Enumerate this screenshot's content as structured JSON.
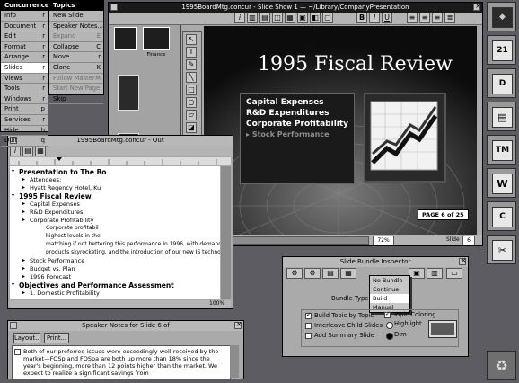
{
  "menu_main": {
    "title": "Concurrence",
    "items": [
      {
        "label": "Info",
        "key": "r"
      },
      {
        "label": "Document",
        "key": "r"
      },
      {
        "label": "Edit",
        "key": "r"
      },
      {
        "label": "Format",
        "key": "r"
      },
      {
        "label": "Arrange",
        "key": "r"
      },
      {
        "label": "Slides",
        "key": "r"
      },
      {
        "label": "Views",
        "key": "r"
      },
      {
        "label": "Tools",
        "key": "r"
      },
      {
        "label": "Windows",
        "key": "r"
      },
      {
        "label": "Print",
        "key": "p"
      },
      {
        "label": "Services",
        "key": "r"
      },
      {
        "label": "Hide",
        "key": "h"
      },
      {
        "label": "Quit",
        "key": "q"
      }
    ]
  },
  "menu_topics": {
    "title": "Topics",
    "items": [
      {
        "label": "New Slide",
        "key": ""
      },
      {
        "label": "Speaker Notes...",
        "key": ""
      },
      {
        "label": "Expand",
        "key": "E"
      },
      {
        "label": "Collapse",
        "key": "C"
      },
      {
        "label": "Move",
        "key": "r"
      },
      {
        "label": "Clone",
        "key": "K"
      },
      {
        "label": "Follow Master",
        "key": "M"
      },
      {
        "label": "Start New Page",
        "key": ""
      },
      {
        "label": "Skip",
        "key": ""
      }
    ]
  },
  "slideshow": {
    "title": "1995BoardMtg.concur - Slide Show 1  —  ~/Library/CompanyPresentation",
    "thumb_finance": "Finance",
    "slide_title": "1995 Fiscal Review",
    "bullets": [
      "Capital Expenses",
      "R&D Expenditures",
      "Corporate Profitability",
      "Stock Performance"
    ],
    "page_badge": "PAGE 6 of 25",
    "zoom": "72%",
    "slide_label": "Slide",
    "slide_num": "6"
  },
  "outline": {
    "title": "1995BoardMtg.concur - Out",
    "lines": [
      {
        "text": "Presentation to The Bo",
        "indent": 0,
        "bold": true
      },
      {
        "text": "Attendees:",
        "indent": 1,
        "bold": false
      },
      {
        "text": "Hyatt Regency Hotel, Ku",
        "indent": 1,
        "bold": false
      },
      {
        "text": "1995 Fiscal Review",
        "indent": 0,
        "bold": true
      },
      {
        "text": "Capital Expenses",
        "indent": 1,
        "bold": false
      },
      {
        "text": "R&D Expenditures",
        "indent": 1,
        "bold": false
      },
      {
        "text": "Corporate Profitability",
        "indent": 1,
        "bold": false
      },
      {
        "text": "Corporate profitabil",
        "indent": 2,
        "bold": false
      },
      {
        "text": "highest levels in the",
        "indent": 2,
        "bold": false
      },
      {
        "text": "matching if not bettering this performance in 1996, with demand for our",
        "indent": 2,
        "bold": false
      },
      {
        "text": "products skyrocketing, and the introduction of our new IS technology.",
        "indent": 2,
        "bold": false
      },
      {
        "text": "Stock Performance",
        "indent": 1,
        "bold": false
      },
      {
        "text": "Budget vs. Plan",
        "indent": 1,
        "bold": false
      },
      {
        "text": "1996 Forecast",
        "indent": 1,
        "bold": false
      },
      {
        "text": "Objectives and Performance Assessment",
        "indent": 0,
        "bold": true
      },
      {
        "text": "1. Domestic Profitability",
        "indent": 1,
        "bold": false
      }
    ],
    "zoom": "100%"
  },
  "notes": {
    "title": "Speaker Notes for Slide 6 of",
    "layout_btn": "Layout...",
    "print_btn": "Print...",
    "text": "Both of our preferred issues were exceedingly well received by the market—FOSp and FOSpa are both up more than 18% since the year's beginning, more than 12 points higher than the market. We expect to realize a significant savings from"
  },
  "inspector": {
    "title": "Slide Bundle Inspector",
    "bundle_type_label": "Bundle Type",
    "options": [
      "No Bundle",
      "Continue",
      "Build",
      "Manual"
    ],
    "selected": "Build",
    "checks": [
      {
        "label": "Build Topic by Topic",
        "checked": true
      },
      {
        "label": "Interleave Child Slides",
        "checked": false
      },
      {
        "label": "Add Summary Slide",
        "checked": false
      }
    ],
    "topic_coloring": "Topic Coloring",
    "radio_highlight": "Highlight",
    "radio_dim": "Dim"
  },
  "chart_icon_note": "",
  "dock": {
    "icons": [
      "next-cube",
      "calendar-21",
      "document-d",
      "terminal",
      "document-tm",
      "pen-w",
      "document-c",
      "scissors",
      "recycler"
    ]
  },
  "colors": {
    "desktop": "#5c5c62",
    "slide_box": "#1a1a1a",
    "menu_bg": "#b6b6b6"
  }
}
